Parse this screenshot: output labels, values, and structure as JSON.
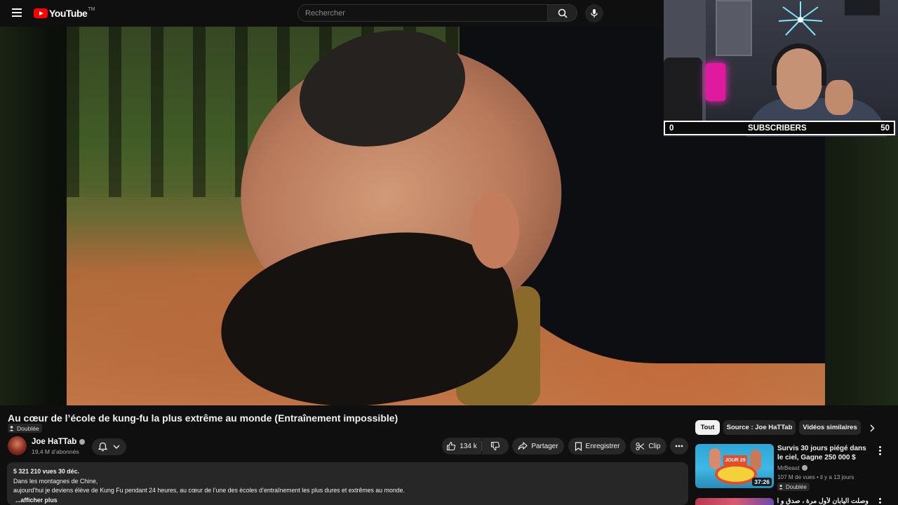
{
  "header": {
    "logo_text": "YouTube",
    "logo_tm": "TM",
    "search_placeholder": "Rechercher"
  },
  "overlay": {
    "subscribers_label": "SUBSCRIBERS",
    "progress_start": "0",
    "progress_goal": "50"
  },
  "video": {
    "title": "Au cœur de l’école de kung-fu la plus extrême au monde (Entraînement impossible)",
    "dub_label": "Doublée"
  },
  "channel": {
    "name": "Joe HaTTab",
    "subscribers": "19,4 M d’abonnés"
  },
  "actions": {
    "likes": "134 k",
    "share": "Partager",
    "save": "Enregistrer",
    "clip": "Clip"
  },
  "description": {
    "meta": "5 321 210 vues  30 déc.",
    "line1": "Dans les montagnes de Chine,",
    "line2": "aujourd’hui je deviens élève de Kung Fu pendant 24 heures, au cœur de l’une des écoles d’entraînement les plus dures et extrêmes au monde.",
    "more": "...afficher plus"
  },
  "chips": [
    {
      "label": "Tout"
    },
    {
      "label": "Source : Joe HaTTab"
    },
    {
      "label": "Vidéos similaires"
    }
  ],
  "recommendations": [
    {
      "title": "Survis 30 jours piégé dans le ciel, Gagne 250 000 $",
      "channel": "MrBeast",
      "meta": "107 M de vues • il y a 13 jours",
      "duration": "37:26",
      "badge": "Doublée",
      "thumb_text": "JOUR 29"
    },
    {
      "title": "وصلت اليابان لأول مرة ، صدق و اكل"
    }
  ],
  "colors": {
    "background": "#0f0f0f",
    "brand_red": "#ff0000",
    "chip_bg": "#272727",
    "text_secondary": "#aaaaaa"
  }
}
